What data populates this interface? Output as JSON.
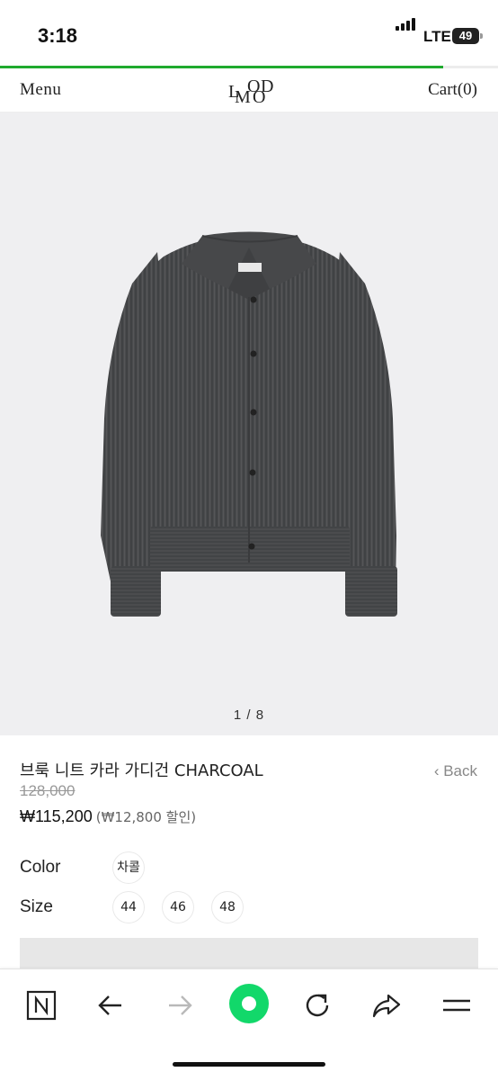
{
  "status_bar": {
    "time": "3:18",
    "network": "LTE",
    "battery": "49"
  },
  "page_load_progress": 0.89,
  "colors": {
    "accent_green": "#1faa2e",
    "sweater": "#4a4b4d",
    "hero_bg": "#efeff1"
  },
  "header": {
    "menu": "Menu",
    "logo": [
      "L",
      "O",
      "D",
      "M",
      "O"
    ],
    "cart": "Cart(0)"
  },
  "gallery": {
    "pager": "1 / 8",
    "image": "charcoal-collar-knit-cardigan"
  },
  "product": {
    "name": "브룩 니트 카라 가디건 CHARCOAL",
    "back": "‹ Back",
    "original_price": "128,000",
    "sale_price": "₩115,200",
    "discount": "(₩12,800 할인)"
  },
  "options": {
    "color_label": "Color",
    "colors": [
      "차콜"
    ],
    "size_label": "Size",
    "sizes": [
      "44",
      "46",
      "48"
    ]
  },
  "toolbar": {
    "icons": [
      "naver-n-icon",
      "back-arrow-icon",
      "forward-arrow-icon",
      "green-home-icon",
      "reload-icon",
      "share-icon",
      "menu-icon"
    ]
  }
}
